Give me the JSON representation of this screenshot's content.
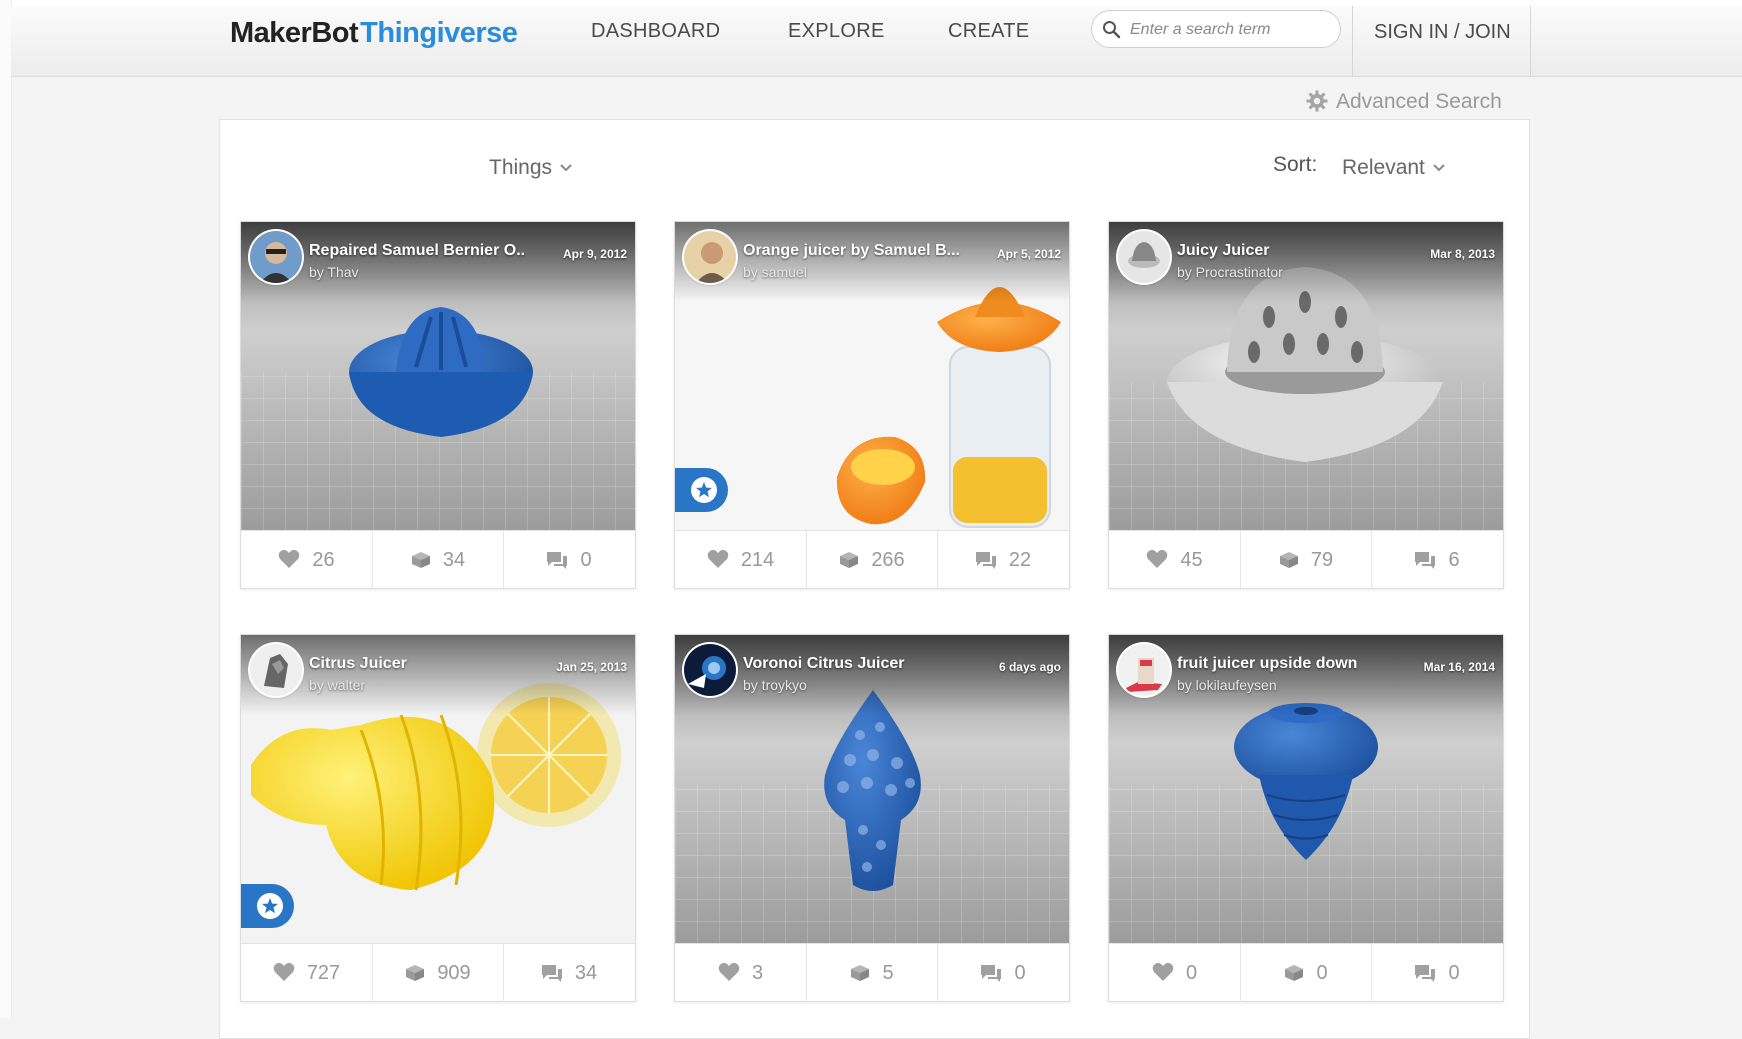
{
  "header": {
    "logo_part1": "MakerBot",
    "logo_part2": "Thingiverse",
    "nav": [
      "DASHBOARD",
      "EXPLORE",
      "CREATE"
    ],
    "search_placeholder": "Enter a search term",
    "signin": "SIGN IN / JOIN"
  },
  "advanced_search": "Advanced Search",
  "filter": {
    "type": "Things",
    "sort_label": "Sort:",
    "sort_value": "Relevant"
  },
  "colors": {
    "brand_blue": "#2a8cdc",
    "featured_blue": "#2a76c6"
  },
  "cards": [
    {
      "title": "Repaired Samuel Bernier O..",
      "author": "by Thav",
      "date": "Apr 9, 2012",
      "likes": "26",
      "collects": "34",
      "comments": "0",
      "featured": false
    },
    {
      "title": "Orange juicer by Samuel B...",
      "author": "by samuel",
      "date": "Apr 5, 2012",
      "likes": "214",
      "collects": "266",
      "comments": "22",
      "featured": true
    },
    {
      "title": "Juicy Juicer",
      "author": "by Procrastinator",
      "date": "Mar 8, 2013",
      "likes": "45",
      "collects": "79",
      "comments": "6",
      "featured": false
    },
    {
      "title": "Citrus Juicer",
      "author": "by walter",
      "date": "Jan 25, 2013",
      "likes": "727",
      "collects": "909",
      "comments": "34",
      "featured": true
    },
    {
      "title": "Voronoi Citrus Juicer",
      "author": "by troykyo",
      "date": "6 days ago",
      "likes": "3",
      "collects": "5",
      "comments": "0",
      "featured": false
    },
    {
      "title": "fruit juicer upside down",
      "author": "by lokilaufeysen",
      "date": "Mar 16, 2014",
      "likes": "0",
      "collects": "0",
      "comments": "0",
      "featured": false
    }
  ]
}
